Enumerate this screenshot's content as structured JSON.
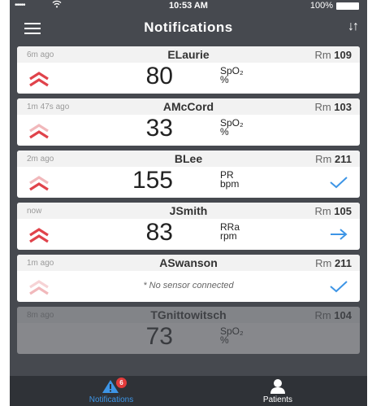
{
  "status_bar": {
    "signal": "•••••",
    "time": "10:53 AM",
    "battery": "100%"
  },
  "header": {
    "title": "Notifications"
  },
  "notifications": [
    {
      "ago": "6m ago",
      "patient": "ELaurie",
      "room_prefix": "Rm",
      "room": "109",
      "value": "80",
      "unit_line1": "SpO₂",
      "unit_line2": "%",
      "severity_icon": "chevron-up-red-icon",
      "action_icon": ""
    },
    {
      "ago": "1m 47s ago",
      "patient": "AMcCord",
      "room_prefix": "Rm",
      "room": "103",
      "value": "33",
      "unit_line1": "SpO₂",
      "unit_line2": "%",
      "severity_icon": "chevron-up-red-icon",
      "action_icon": ""
    },
    {
      "ago": "2m ago",
      "patient": "BLee",
      "room_prefix": "Rm",
      "room": "211",
      "value": "155",
      "unit_line1": "PR",
      "unit_line2": "bpm",
      "severity_icon": "chevron-up-red-icon",
      "action_icon": "checkmark-icon"
    },
    {
      "ago": "now",
      "patient": "JSmith",
      "room_prefix": "Rm",
      "room": "105",
      "value": "83",
      "unit_line1": "RRa",
      "unit_line2": "rpm",
      "severity_icon": "chevron-up-red-icon",
      "action_icon": "arrow-right-icon"
    },
    {
      "ago": "1m ago",
      "patient": "ASwanson",
      "room_prefix": "Rm",
      "room": "211",
      "value": "",
      "note": "* No sensor connected",
      "severity_icon": "chevron-up-pale-icon",
      "action_icon": "checkmark-icon"
    },
    {
      "ago": "8m ago",
      "patient": "TGnittowitsch",
      "room_prefix": "Rm",
      "room": "104",
      "value": "73",
      "unit_line1": "SpO₂",
      "unit_line2": "%",
      "severity_icon": "",
      "action_icon": ""
    }
  ],
  "tabbar": {
    "notifications_label": "Notifications",
    "notifications_badge": "6",
    "patients_label": "Patients"
  },
  "colors": {
    "accent": "#3d95e6",
    "alert_red": "#e0434b",
    "background": "#46494f",
    "tabbar": "#2f3237"
  }
}
